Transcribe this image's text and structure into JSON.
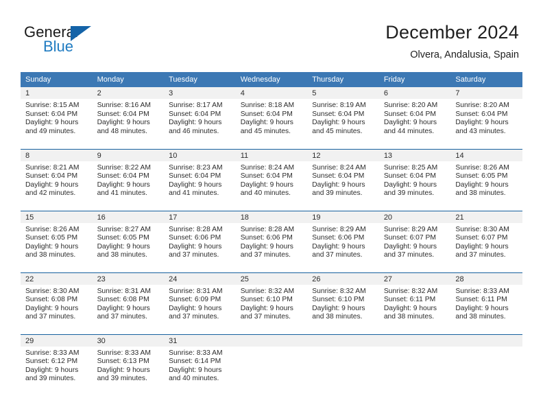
{
  "brand": {
    "line1": "General",
    "line2": "Blue",
    "accent_color": "#1463a8",
    "blue_text_color": "#1f7bc1"
  },
  "header": {
    "title": "December 2024",
    "subtitle": "Olvera, Andalusia, Spain"
  },
  "theme": {
    "header_row_background": "#3c78b4",
    "header_row_text": "#ffffff",
    "day_band_background": "#f1f1f1",
    "row_divider": "#16609e",
    "cell_background": "#ffffff",
    "body_text": "#2b2b2b"
  },
  "weekday_headers": [
    "Sunday",
    "Monday",
    "Tuesday",
    "Wednesday",
    "Thursday",
    "Friday",
    "Saturday"
  ],
  "weeks": [
    [
      {
        "day": "1",
        "sunrise": "Sunrise: 8:15 AM",
        "sunset": "Sunset: 6:04 PM",
        "daylight1": "Daylight: 9 hours",
        "daylight2": "and 49 minutes."
      },
      {
        "day": "2",
        "sunrise": "Sunrise: 8:16 AM",
        "sunset": "Sunset: 6:04 PM",
        "daylight1": "Daylight: 9 hours",
        "daylight2": "and 48 minutes."
      },
      {
        "day": "3",
        "sunrise": "Sunrise: 8:17 AM",
        "sunset": "Sunset: 6:04 PM",
        "daylight1": "Daylight: 9 hours",
        "daylight2": "and 46 minutes."
      },
      {
        "day": "4",
        "sunrise": "Sunrise: 8:18 AM",
        "sunset": "Sunset: 6:04 PM",
        "daylight1": "Daylight: 9 hours",
        "daylight2": "and 45 minutes."
      },
      {
        "day": "5",
        "sunrise": "Sunrise: 8:19 AM",
        "sunset": "Sunset: 6:04 PM",
        "daylight1": "Daylight: 9 hours",
        "daylight2": "and 45 minutes."
      },
      {
        "day": "6",
        "sunrise": "Sunrise: 8:20 AM",
        "sunset": "Sunset: 6:04 PM",
        "daylight1": "Daylight: 9 hours",
        "daylight2": "and 44 minutes."
      },
      {
        "day": "7",
        "sunrise": "Sunrise: 8:20 AM",
        "sunset": "Sunset: 6:04 PM",
        "daylight1": "Daylight: 9 hours",
        "daylight2": "and 43 minutes."
      }
    ],
    [
      {
        "day": "8",
        "sunrise": "Sunrise: 8:21 AM",
        "sunset": "Sunset: 6:04 PM",
        "daylight1": "Daylight: 9 hours",
        "daylight2": "and 42 minutes."
      },
      {
        "day": "9",
        "sunrise": "Sunrise: 8:22 AM",
        "sunset": "Sunset: 6:04 PM",
        "daylight1": "Daylight: 9 hours",
        "daylight2": "and 41 minutes."
      },
      {
        "day": "10",
        "sunrise": "Sunrise: 8:23 AM",
        "sunset": "Sunset: 6:04 PM",
        "daylight1": "Daylight: 9 hours",
        "daylight2": "and 41 minutes."
      },
      {
        "day": "11",
        "sunrise": "Sunrise: 8:24 AM",
        "sunset": "Sunset: 6:04 PM",
        "daylight1": "Daylight: 9 hours",
        "daylight2": "and 40 minutes."
      },
      {
        "day": "12",
        "sunrise": "Sunrise: 8:24 AM",
        "sunset": "Sunset: 6:04 PM",
        "daylight1": "Daylight: 9 hours",
        "daylight2": "and 39 minutes."
      },
      {
        "day": "13",
        "sunrise": "Sunrise: 8:25 AM",
        "sunset": "Sunset: 6:04 PM",
        "daylight1": "Daylight: 9 hours",
        "daylight2": "and 39 minutes."
      },
      {
        "day": "14",
        "sunrise": "Sunrise: 8:26 AM",
        "sunset": "Sunset: 6:05 PM",
        "daylight1": "Daylight: 9 hours",
        "daylight2": "and 38 minutes."
      }
    ],
    [
      {
        "day": "15",
        "sunrise": "Sunrise: 8:26 AM",
        "sunset": "Sunset: 6:05 PM",
        "daylight1": "Daylight: 9 hours",
        "daylight2": "and 38 minutes."
      },
      {
        "day": "16",
        "sunrise": "Sunrise: 8:27 AM",
        "sunset": "Sunset: 6:05 PM",
        "daylight1": "Daylight: 9 hours",
        "daylight2": "and 38 minutes."
      },
      {
        "day": "17",
        "sunrise": "Sunrise: 8:28 AM",
        "sunset": "Sunset: 6:06 PM",
        "daylight1": "Daylight: 9 hours",
        "daylight2": "and 37 minutes."
      },
      {
        "day": "18",
        "sunrise": "Sunrise: 8:28 AM",
        "sunset": "Sunset: 6:06 PM",
        "daylight1": "Daylight: 9 hours",
        "daylight2": "and 37 minutes."
      },
      {
        "day": "19",
        "sunrise": "Sunrise: 8:29 AM",
        "sunset": "Sunset: 6:06 PM",
        "daylight1": "Daylight: 9 hours",
        "daylight2": "and 37 minutes."
      },
      {
        "day": "20",
        "sunrise": "Sunrise: 8:29 AM",
        "sunset": "Sunset: 6:07 PM",
        "daylight1": "Daylight: 9 hours",
        "daylight2": "and 37 minutes."
      },
      {
        "day": "21",
        "sunrise": "Sunrise: 8:30 AM",
        "sunset": "Sunset: 6:07 PM",
        "daylight1": "Daylight: 9 hours",
        "daylight2": "and 37 minutes."
      }
    ],
    [
      {
        "day": "22",
        "sunrise": "Sunrise: 8:30 AM",
        "sunset": "Sunset: 6:08 PM",
        "daylight1": "Daylight: 9 hours",
        "daylight2": "and 37 minutes."
      },
      {
        "day": "23",
        "sunrise": "Sunrise: 8:31 AM",
        "sunset": "Sunset: 6:08 PM",
        "daylight1": "Daylight: 9 hours",
        "daylight2": "and 37 minutes."
      },
      {
        "day": "24",
        "sunrise": "Sunrise: 8:31 AM",
        "sunset": "Sunset: 6:09 PM",
        "daylight1": "Daylight: 9 hours",
        "daylight2": "and 37 minutes."
      },
      {
        "day": "25",
        "sunrise": "Sunrise: 8:32 AM",
        "sunset": "Sunset: 6:10 PM",
        "daylight1": "Daylight: 9 hours",
        "daylight2": "and 37 minutes."
      },
      {
        "day": "26",
        "sunrise": "Sunrise: 8:32 AM",
        "sunset": "Sunset: 6:10 PM",
        "daylight1": "Daylight: 9 hours",
        "daylight2": "and 38 minutes."
      },
      {
        "day": "27",
        "sunrise": "Sunrise: 8:32 AM",
        "sunset": "Sunset: 6:11 PM",
        "daylight1": "Daylight: 9 hours",
        "daylight2": "and 38 minutes."
      },
      {
        "day": "28",
        "sunrise": "Sunrise: 8:33 AM",
        "sunset": "Sunset: 6:11 PM",
        "daylight1": "Daylight: 9 hours",
        "daylight2": "and 38 minutes."
      }
    ],
    [
      {
        "day": "29",
        "sunrise": "Sunrise: 8:33 AM",
        "sunset": "Sunset: 6:12 PM",
        "daylight1": "Daylight: 9 hours",
        "daylight2": "and 39 minutes."
      },
      {
        "day": "30",
        "sunrise": "Sunrise: 8:33 AM",
        "sunset": "Sunset: 6:13 PM",
        "daylight1": "Daylight: 9 hours",
        "daylight2": "and 39 minutes."
      },
      {
        "day": "31",
        "sunrise": "Sunrise: 8:33 AM",
        "sunset": "Sunset: 6:14 PM",
        "daylight1": "Daylight: 9 hours",
        "daylight2": "and 40 minutes."
      },
      {
        "day": "",
        "sunrise": "",
        "sunset": "",
        "daylight1": "",
        "daylight2": ""
      },
      {
        "day": "",
        "sunrise": "",
        "sunset": "",
        "daylight1": "",
        "daylight2": ""
      },
      {
        "day": "",
        "sunrise": "",
        "sunset": "",
        "daylight1": "",
        "daylight2": ""
      },
      {
        "day": "",
        "sunrise": "",
        "sunset": "",
        "daylight1": "",
        "daylight2": ""
      }
    ]
  ]
}
